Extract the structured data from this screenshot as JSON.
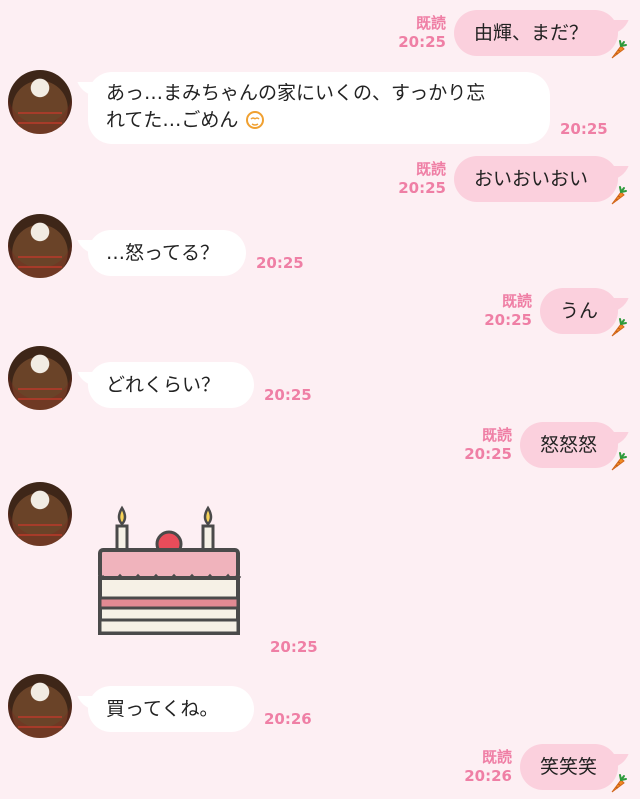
{
  "colors": {
    "background": "#fdeff3",
    "outgoing_bubble": "#fbd0dd",
    "incoming_bubble": "#ffffff",
    "meta_text": "#ef7fa5"
  },
  "messages": [
    {
      "side": "out",
      "text": "由輝、まだ？",
      "read": "既読",
      "time": "20:25"
    },
    {
      "side": "in",
      "line1": "あっ…まみちゃんの家にいくの、すっかり忘",
      "line2": "れてた…ごめん",
      "emoji": "sweat-face-icon",
      "time": "20:25"
    },
    {
      "side": "out",
      "text": "おいおいおい",
      "read": "既読",
      "time": "20:25"
    },
    {
      "side": "in",
      "text": "…怒ってる？",
      "time": "20:25"
    },
    {
      "side": "out",
      "text": "うん",
      "read": "既読",
      "time": "20:25"
    },
    {
      "side": "in",
      "text": "どれくらい？",
      "time": "20:25"
    },
    {
      "side": "out",
      "text": "怒怒怒",
      "read": "既読",
      "time": "20:25"
    },
    {
      "side": "in",
      "sticker": "strawberry-cake-sticker",
      "time": "20:25"
    },
    {
      "side": "in",
      "text": "買ってくね。",
      "time": "20:26"
    },
    {
      "side": "out",
      "text": "笑笑笑",
      "read": "既読",
      "time": "20:26"
    }
  ]
}
